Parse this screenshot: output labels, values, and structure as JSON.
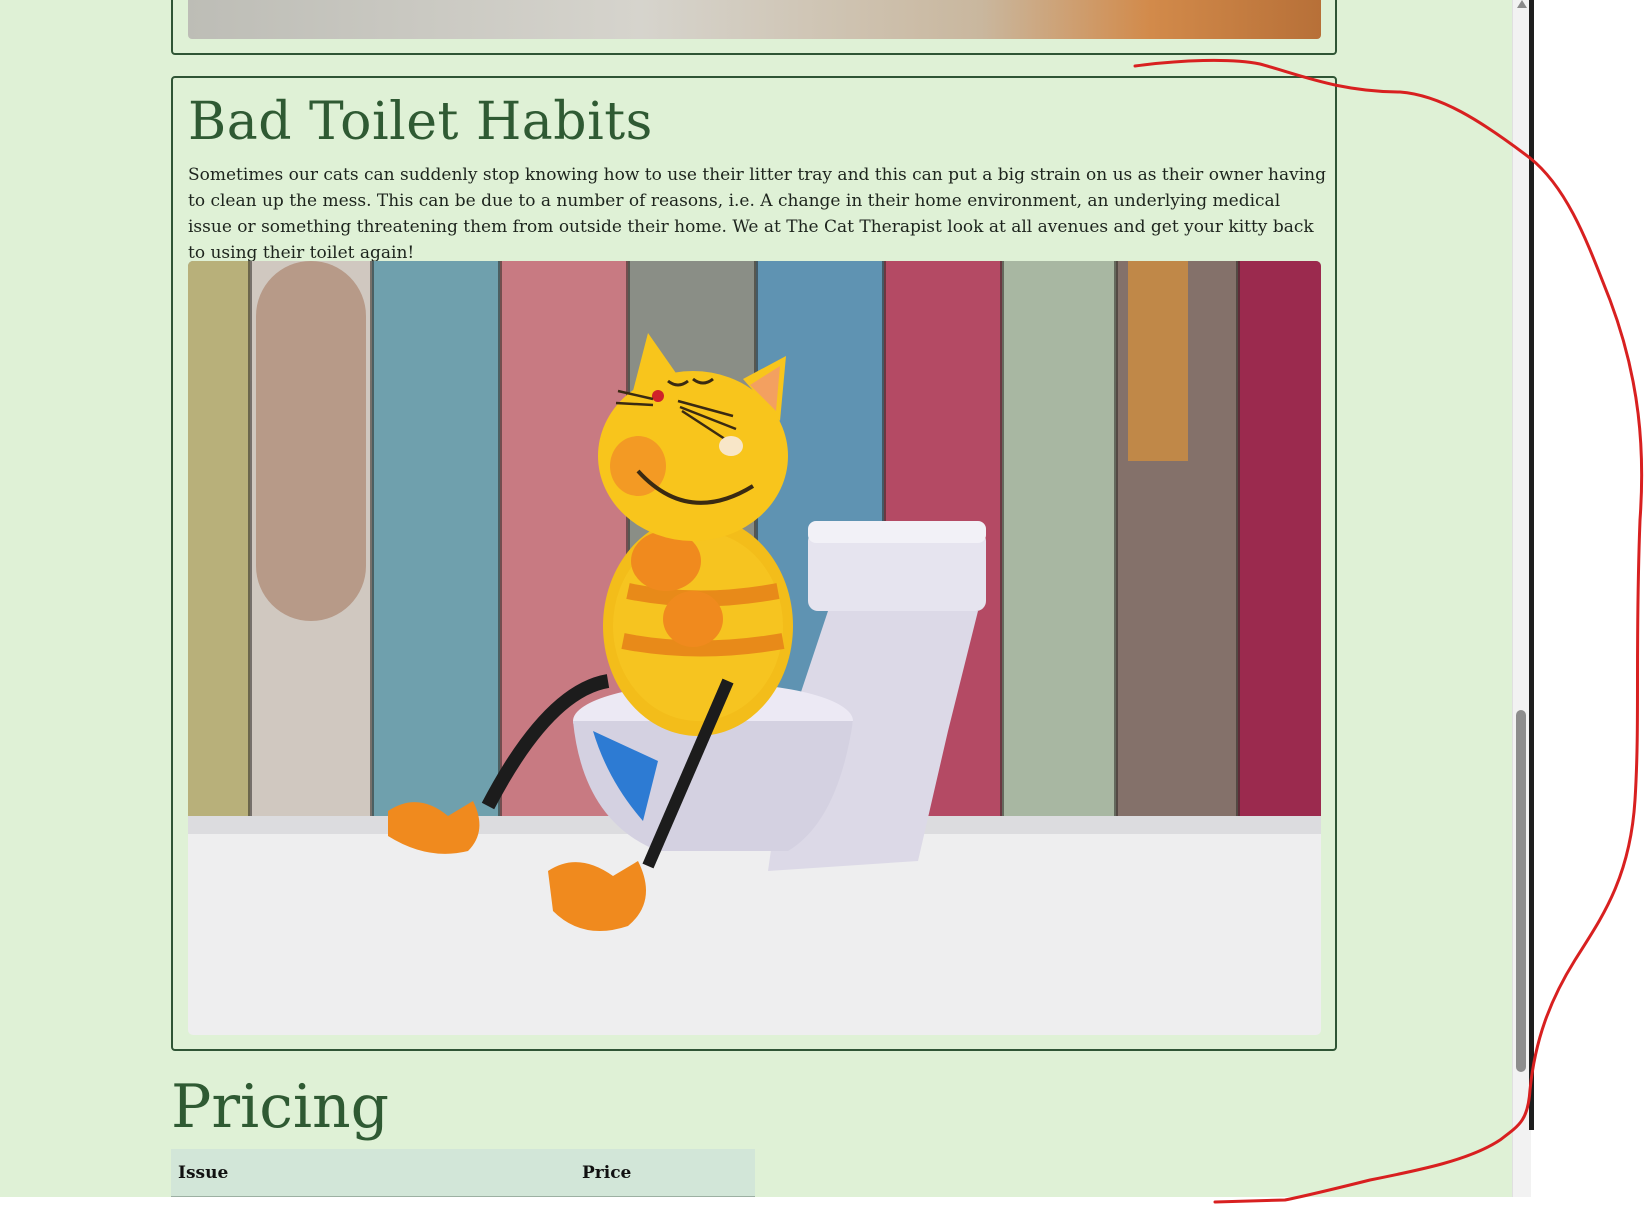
{
  "section": {
    "title": "Bad Toilet Habits",
    "body": "Sometimes our cats can suddenly stop knowing how to use their litter tray and this can put a big strain on us as their owner having to clean up the mess. This can be due to a number of reasons, i.e. A change in their home environment, an underlying medical issue or something threatening them from outside their home. We at The Cat Therapist look at all avenues and get your kitty back to using their toilet again!"
  },
  "pricing": {
    "title": "Pricing",
    "columns": [
      "Issue",
      "Price"
    ]
  },
  "colors": {
    "page_bg": "#dff1d6",
    "heading": "#2f5a33",
    "card_border": "#2f5535",
    "table_header_bg": "#d2e6d8",
    "annotation": "#d82020"
  },
  "icons": [
    "scroll-up-arrow-icon"
  ]
}
